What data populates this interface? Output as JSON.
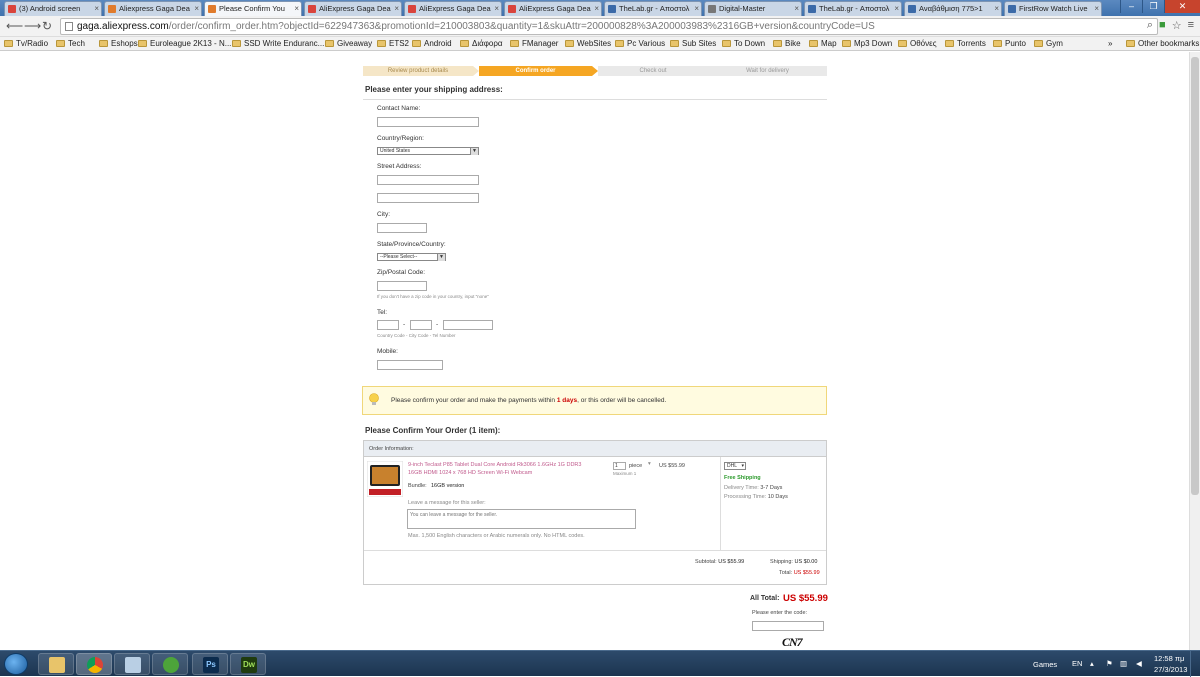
{
  "browser": {
    "tabs": [
      {
        "title": "(3) Android screen",
        "color": "#d9443c"
      },
      {
        "title": "Aliexpress Gaga Dea",
        "color": "#e07b2c"
      },
      {
        "title": "Please Confirm You",
        "color": "#e07b2c",
        "active": true
      },
      {
        "title": "AliExpress Gaga Dea",
        "color": "#d9443c"
      },
      {
        "title": "AliExpress Gaga Dea",
        "color": "#d9443c"
      },
      {
        "title": "AliExpress Gaga Dea",
        "color": "#d9443c"
      },
      {
        "title": "TheLab.gr - Αποστολ",
        "color": "#3b6aa8"
      },
      {
        "title": "Digital-Master",
        "color": "#777777"
      },
      {
        "title": "TheLab.gr - Αποστολ",
        "color": "#3b6aa8"
      },
      {
        "title": "Αναβάθμιση 775>1",
        "color": "#3b6aa8"
      },
      {
        "title": "FirstRow Watch Live",
        "color": "#3b6aa8"
      }
    ],
    "url_host": "gaga.aliexpress.com",
    "url_path": "/order/confirm_order.htm?objectId=622947363&promotionId=210003803&quantity=1&skuAttr=200000828%3A200003983%2316GB+version&countryCode=US",
    "bookmarks": [
      "Tv/Radio",
      "Tech",
      "Eshops",
      "Euroleague 2K13 - N...",
      "SSD Write Enduranc...",
      "Giveaway",
      "ETS2",
      "Android",
      "Διάφορα",
      "FManager",
      "WebSites",
      "Pc Various",
      "Sub Sites",
      "To Down",
      "Bike",
      "Map",
      "Mp3 Down",
      "Οθόνες",
      "Torrents",
      "Punto",
      "Gym"
    ],
    "other_bookmarks": "Other bookmarks",
    "overflow": "»"
  },
  "steps": [
    "Review product details",
    "Confirm order",
    "Check out",
    "Wait for delivery"
  ],
  "shipping": {
    "heading": "Please enter your shipping address:",
    "contact_label": "Contact Name:",
    "country_label": "Country/Region:",
    "country_value": "United States",
    "street_label": "Street Address:",
    "city_label": "City:",
    "state_label": "State/Province/Country:",
    "state_value": "--Please Select--",
    "zip_label": "Zip/Postal Code:",
    "zip_hint": "If you don't have a zip code in your country, input \"none\"",
    "tel_label": "Tel:",
    "tel_dash": "-",
    "tel_hint": "Country Code - City Code - Tel Number",
    "mobile_label": "Mobile:"
  },
  "notice": {
    "before": "Please confirm your order and make the payments within ",
    "days": "1 days",
    "after": ", or this order will be cancelled."
  },
  "order": {
    "heading": "Please Confirm Your Order (1 item):",
    "info_label": "Order Information:",
    "product_title_1": "9-inch Teclast P85 Tablet Dual Core Android Rk3066 1.6GHz 1G DDR3",
    "product_title_2": "16GB HDMI 1024 x 768 HD Screen Wi-Fi Webcam",
    "bundle_label": "Bundle:",
    "bundle_value": "16GB version",
    "qty": "1",
    "qty_unit": "piece",
    "qty_max": "Maximum 1",
    "price": "US $55.99",
    "shipping_method": "DHL",
    "free_shipping": "Free Shipping",
    "delivery_time_label": "Delivery Time:",
    "delivery_time": "3-7 Days",
    "processing_time_label": "Processing Time:",
    "processing_time": "10 Days",
    "message_label": "Leave a message for this seller:",
    "message_placeholder": "You can leave a message for the seller.",
    "message_hint": "Max. 1,500 English characters or Arabic numerals only.  No HTML codes.",
    "subtotal_label": "Subtotal:",
    "subtotal": "US $55.99",
    "shipping_label": "Shipping:",
    "shipping_cost": "US $0.00",
    "total_label": "Total:",
    "total": "US $55.99",
    "all_total_label": "All Total:",
    "all_total": "US $55.99",
    "code_label": "Please enter the code:",
    "captcha": "CN7"
  },
  "taskbar": {
    "games": "Games",
    "lang": "EN",
    "time": "12:58 πμ",
    "date": "27/3/2013"
  }
}
